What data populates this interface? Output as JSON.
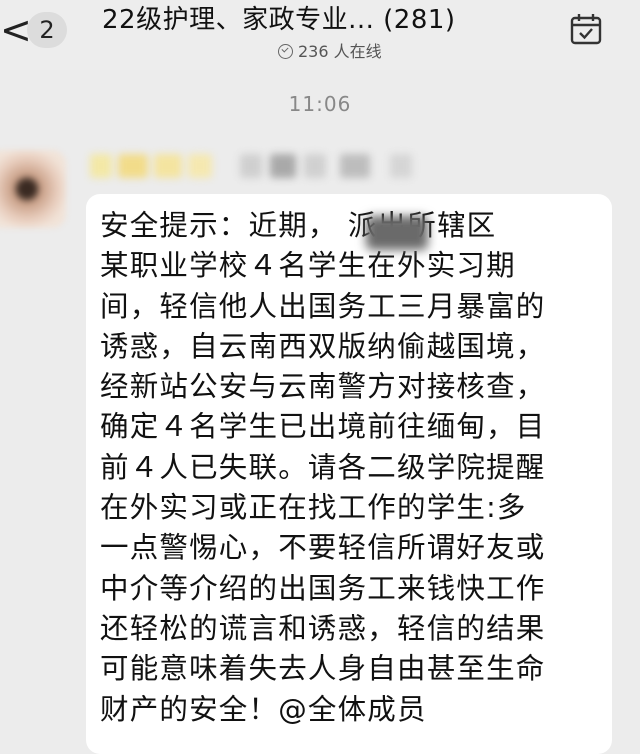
{
  "header": {
    "back_symbol": "<",
    "unread_count": "2",
    "title": "22级护理、家政专业... (281)",
    "online_count": "236 人在线"
  },
  "timestamp": "11:06",
  "message": {
    "text": "安全提示：近期，        派出所辖区\n某职业学校４名学生在外实习期\n间，轻信他人出国务工三月暴富的\n诱惑，自云南西双版纳偷越国境，\n经新站公安与云南警方对接核查，\n确定４名学生已出境前往缅甸，目\n前４人已失联。请各二级学院提醒\n在外实习或正在找工作的学生:多\n一点警惕心，不要轻信所谓好友或\n中介等介绍的出国务工来钱快工作\n还轻松的谎言和诱惑，轻信的结果\n可能意味着失去人身自由甚至生命\n财产的安全！@全体成员"
  },
  "icons": {
    "back": "chevron-left-icon",
    "online": "check-circle-icon",
    "calendar": "calendar-check-icon"
  }
}
